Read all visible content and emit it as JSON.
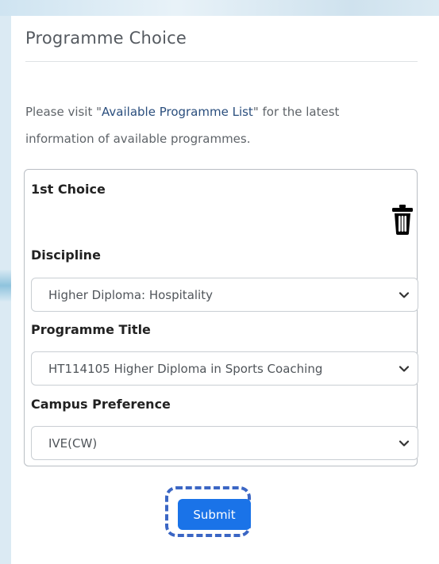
{
  "section": {
    "title": "Programme Choice",
    "info_before": "Please visit \"",
    "info_link": "Available Programme List",
    "info_after": "\" for the latest information of available programmes."
  },
  "choice": {
    "heading": "1st Choice",
    "delete_icon": "trash-icon",
    "fields": [
      {
        "label": "Discipline",
        "value": "Higher Diploma: Hospitality"
      },
      {
        "label": "Programme Title",
        "value": "HT114105 Higher Diploma in Sports Coaching"
      },
      {
        "label": "Campus Preference",
        "value": "IVE(CW)"
      }
    ]
  },
  "actions": {
    "submit_label": "Submit"
  },
  "colors": {
    "accent": "#1a73e8",
    "link": "#2a4e7d",
    "focus_ring": "#3b66c4"
  }
}
